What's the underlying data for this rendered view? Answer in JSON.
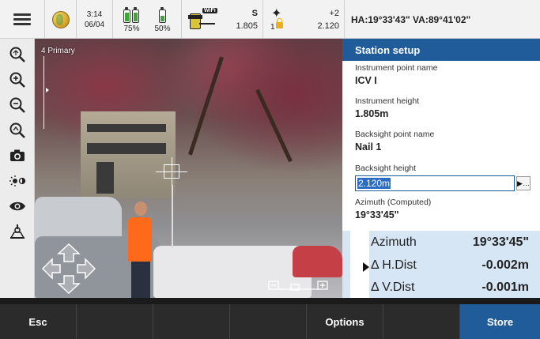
{
  "status": {
    "time": "3:14",
    "date": "06/04",
    "battery_left_pct": "75%",
    "battery_right_pct": "50%",
    "battery_left_level": 0.75,
    "battery_right_level": 0.5,
    "wifi_label": "WiFi",
    "instrument_mode": "S",
    "instrument_height": "1.805",
    "target_number": "1",
    "target_prism_constant": "+2",
    "target_height": "2.120",
    "angles": "HA:19°33'43\"  VA:89°41'02\""
  },
  "camera": {
    "label": "4 Primary"
  },
  "panel": {
    "title": "Station setup",
    "fields": {
      "instrument_point_label": "Instrument point name",
      "instrument_point_value": "ICV I",
      "instrument_height_label": "Instrument height",
      "instrument_height_value": "1.805m",
      "backsight_point_label": "Backsight point name",
      "backsight_point_value": "Nail 1",
      "backsight_height_label": "Backsight height",
      "backsight_height_value": "2.120m",
      "azimuth_computed_label": "Azimuth (Computed)",
      "azimuth_computed_value": "19°33'45\""
    },
    "results": [
      {
        "label": "Azimuth",
        "value": "19°33'45\""
      },
      {
        "label": "Δ H.Dist",
        "value": "-0.002m"
      },
      {
        "label": "Δ V.Dist",
        "value": "-0.001m"
      }
    ]
  },
  "bottom": {
    "esc": "Esc",
    "options": "Options",
    "store": "Store"
  },
  "colors": {
    "accent": "#1f5c99",
    "results_bg": "#d6e6f5"
  }
}
